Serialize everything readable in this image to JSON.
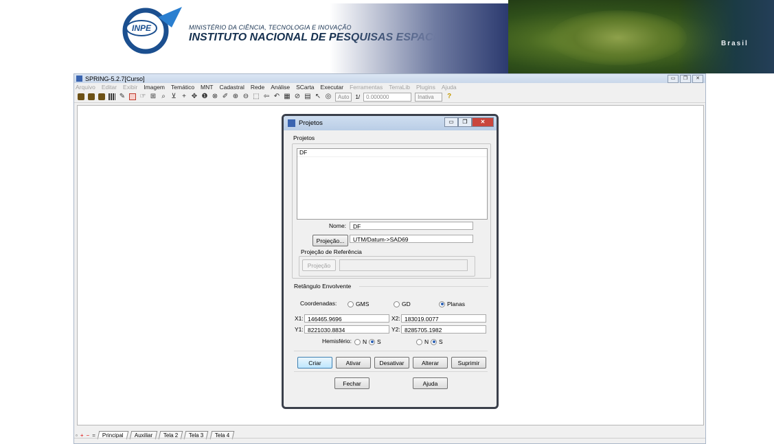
{
  "banner": {
    "logo_text": "INPE",
    "ministry": "MINISTÉRIO DA CIÊNCIA, TECNOLOGIA E INOVAÇÃO",
    "institute": "INSTITUTO NACIONAL DE PESQUISAS ESPACIAIS",
    "map_label": "Brasil"
  },
  "app": {
    "title": "SPRING-5.2.7[Curso]",
    "menu": [
      {
        "label": "Arquivo",
        "enabled": false
      },
      {
        "label": "Editar",
        "enabled": false
      },
      {
        "label": "Exibir",
        "enabled": false
      },
      {
        "label": "Imagem",
        "enabled": true
      },
      {
        "label": "Temático",
        "enabled": true
      },
      {
        "label": "MNT",
        "enabled": true
      },
      {
        "label": "Cadastral",
        "enabled": true
      },
      {
        "label": "Rede",
        "enabled": true
      },
      {
        "label": "Análise",
        "enabled": true
      },
      {
        "label": "SCarta",
        "enabled": true
      },
      {
        "label": "Executar",
        "enabled": true
      },
      {
        "label": "Ferramentas",
        "enabled": false
      },
      {
        "label": "TerraLib",
        "enabled": false
      },
      {
        "label": "Plugins",
        "enabled": false
      },
      {
        "label": "Ajuda",
        "enabled": false
      }
    ],
    "toolbar": {
      "zoom_mode": "Auto",
      "scale_prefix": "1/",
      "scale_value": "0.000000",
      "state": "Inativa",
      "help_glyph": "?"
    },
    "tabs": [
      "Principal",
      "Auxiliar",
      "Tela 2",
      "Tela 3",
      "Tela 4"
    ]
  },
  "dialog": {
    "title": "Projetos",
    "projects_group": "Projetos",
    "projects": [
      "DF"
    ],
    "name_label": "Nome:",
    "name_value": "DF",
    "projection_button": "Projeção...",
    "projection_value": "UTM/Datum->SAD69",
    "ref_group": "Projeção de Referência",
    "ref_button": "Projeção",
    "ref_value": "",
    "bbox_group": "Retângulo Envolvente",
    "coords_label": "Coordenadas:",
    "coord_options": [
      "GMS",
      "GD",
      "Planas"
    ],
    "coord_selected": "Planas",
    "x1_label": "X1:",
    "x1_value": "146465.9696",
    "x2_label": "X2:",
    "x2_value": "183019.0077",
    "y1_label": "Y1:",
    "y1_value": "8221030.8834",
    "y2_label": "Y2:",
    "y2_value": "8285705.1982",
    "hemisphere_label": "Hemisfério:",
    "hemi_n": "N",
    "hemi_s": "S",
    "buttons": {
      "create": "Criar",
      "activate": "Ativar",
      "deactivate": "Desativar",
      "modify": "Alterar",
      "delete": "Suprimir",
      "close": "Fechar",
      "help": "Ajuda"
    }
  }
}
